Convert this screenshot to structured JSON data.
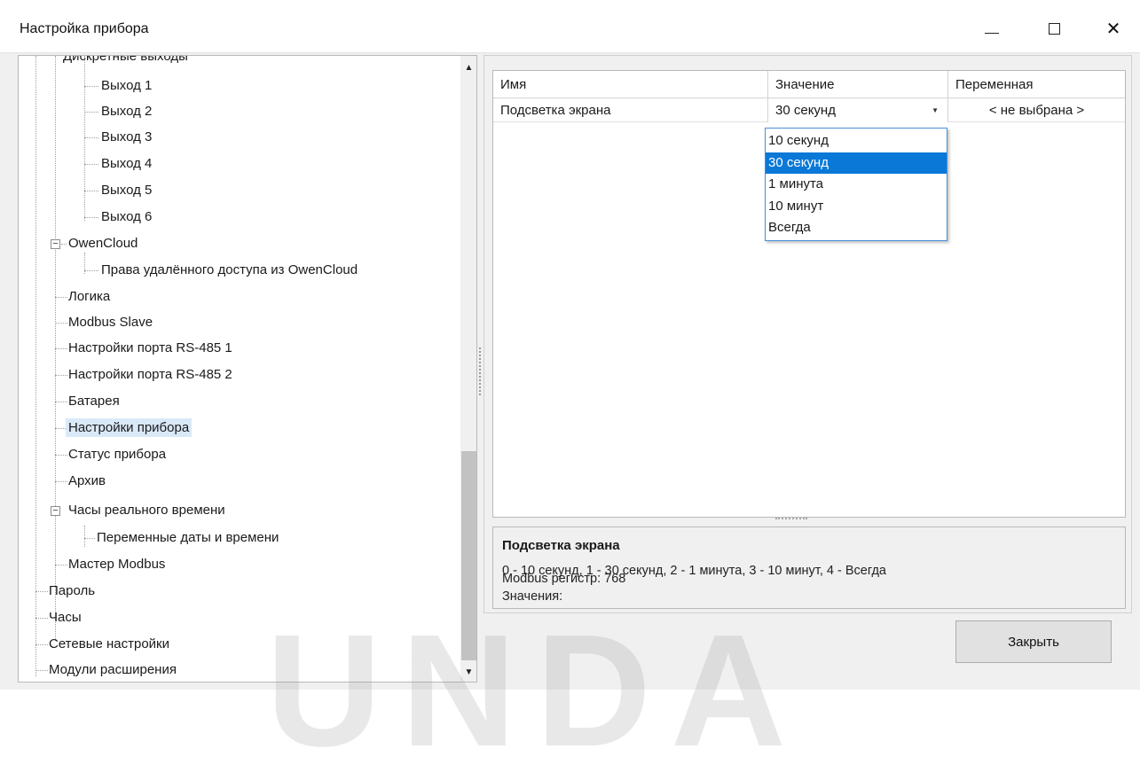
{
  "window": {
    "title": "Настройка прибора",
    "minimize_glyph": "—",
    "maximize_glyph": "☐",
    "close_glyph": "✕"
  },
  "tree": {
    "partial_top_label": "Дискретные выходы",
    "items": [
      {
        "label": "Выход 1"
      },
      {
        "label": "Выход 2"
      },
      {
        "label": "Выход 3"
      },
      {
        "label": "Выход 4"
      },
      {
        "label": "Выход 5"
      },
      {
        "label": "Выход 6"
      },
      {
        "label": "OwenCloud"
      },
      {
        "label": "Права удалённого доступа из OwenCloud"
      },
      {
        "label": "Логика"
      },
      {
        "label": "Modbus Slave"
      },
      {
        "label": "Настройки порта RS-485 1"
      },
      {
        "label": "Настройки порта RS-485 2"
      },
      {
        "label": "Батарея"
      },
      {
        "label": "Настройки прибора",
        "selected": true
      },
      {
        "label": "Статус прибора"
      },
      {
        "label": "Архив"
      },
      {
        "label": "Часы реального времени"
      },
      {
        "label": "Переменные даты и времени"
      },
      {
        "label": "Мастер Modbus"
      },
      {
        "label": "Пароль"
      },
      {
        "label": "Часы"
      },
      {
        "label": "Сетевые настройки"
      },
      {
        "label": "Модули расширения"
      }
    ]
  },
  "grid": {
    "columns": [
      "Имя",
      "Значение",
      "Переменная"
    ],
    "row": {
      "name": "Подсветка экрана",
      "value": "30 секунд",
      "variable": "< не выбрана >"
    },
    "dropdown_options": [
      "10 секунд",
      "30 секунд",
      "1 минута",
      "10 минут",
      "Всегда"
    ],
    "dropdown_selected_index": 1
  },
  "description": {
    "title": "Подсветка экрана",
    "register": "Modbus регистр: 768",
    "values_label": "Значения:",
    "values": "0 - 10 секунд, 1 - 30 секунд, 2 - 1 минута, 3 - 10 минут, 4 - Всегда"
  },
  "buttons": {
    "close": "Закрыть"
  },
  "watermark": "UNDA",
  "colors": {
    "selection_blue": "#0a78d7",
    "tree_selected": "#d9e9f8",
    "window_bg": "#f0f0f0"
  }
}
